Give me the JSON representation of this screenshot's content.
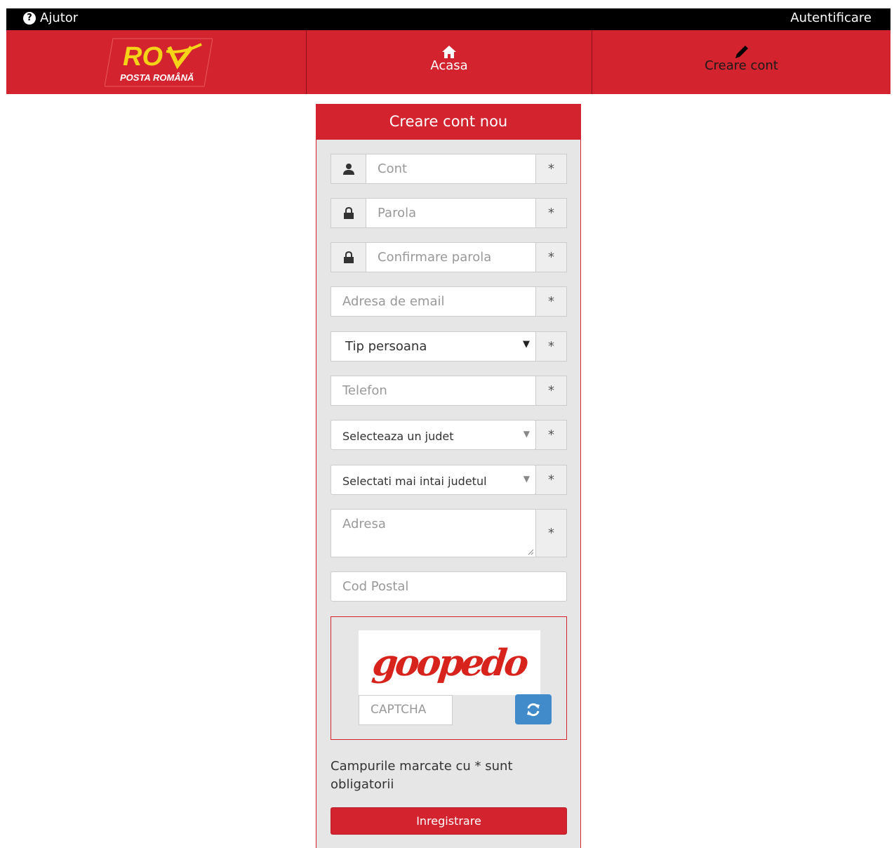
{
  "topbar": {
    "help_label": "Ajutor",
    "login_label": "Autentificare"
  },
  "nav": {
    "logo_text": "POSTA ROMÂNĂ",
    "home_label": "Acasa",
    "create_label": "Creare cont"
  },
  "form": {
    "title": "Creare cont nou",
    "required_mark": "*",
    "account_placeholder": "Cont",
    "password_placeholder": "Parola",
    "confirm_password_placeholder": "Confirmare parola",
    "email_placeholder": "Adresa de email",
    "person_type_value": "Tip persoana",
    "phone_placeholder": "Telefon",
    "county_value": "Selecteaza un judet",
    "locality_value": "Selectati mai intai judetul",
    "address_placeholder": "Adresa",
    "postal_code_placeholder": "Cod Postal",
    "captcha_text": "goopedo",
    "captcha_placeholder": "CAPTCHA",
    "required_note": "Campurile marcate cu * sunt obligatorii",
    "submit_label": "Inregistrare"
  },
  "colors": {
    "brand_red": "#d2232e",
    "captcha_red": "#d8231d",
    "refresh_blue": "#428bca",
    "logo_yellow": "#f5d317"
  }
}
